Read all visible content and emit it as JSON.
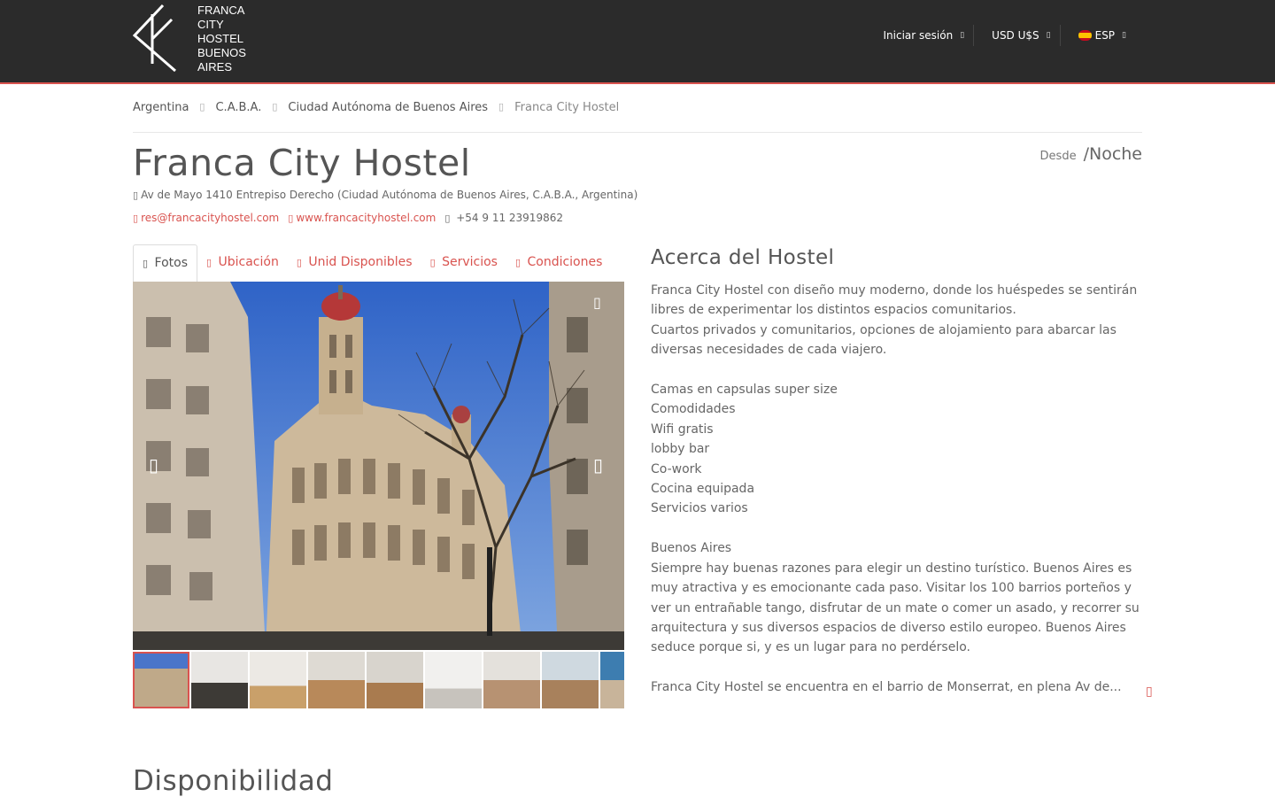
{
  "header": {
    "logo_lines": [
      "FRANCA",
      "CITY",
      "HOSTEL",
      "BUENOS",
      "AIRES"
    ],
    "login": "Iniciar sesión",
    "currency": "USD U$S",
    "language": "ESP"
  },
  "breadcrumb": [
    "Argentina",
    "C.A.B.A.",
    "Ciudad Autónoma de Buenos Aires",
    "Franca City Hostel"
  ],
  "hostel": {
    "name": "Franca City Hostel",
    "price_from": "Desde",
    "price_unit": "/Noche",
    "address": "Av de Mayo 1410 Entrepiso Derecho (Ciudad Autónoma de Buenos Aires, C.A.B.A., Argentina)",
    "email": "res@francacityhostel.com",
    "website": "www.francacityhostel.com",
    "phone": "+54 9 11 23919862"
  },
  "tabs": [
    "Fotos",
    "Ubicación",
    "Unid Disponibles",
    "Servicios",
    "Condiciones"
  ],
  "about": {
    "title": "Acerca del Hostel",
    "lines": [
      "Franca City Hostel con diseño muy moderno, donde los huéspedes se sentirán libres de experimentar los distintos espacios comunitarios.",
      "Cuartos privados y comunitarios, opciones de alojamiento para abarcar las diversas necesidades de cada viajero.",
      "",
      "Camas en capsulas super size",
      "Comodidades",
      "Wifi gratis",
      "lobby bar",
      "Co-work",
      "Cocina equipada",
      "Servicios varios",
      "",
      "Buenos Aires",
      "Siempre hay buenas razones para elegir un destino turístico. Buenos Aires es muy atractiva y es emocionante cada paso. Visitar los 100 barrios porteños y ver un entrañable tango, disfrutar de un mate o comer un asado, y recorrer su arquitectura y sus diversos espacios de diverso estilo europeo. Buenos Aires seduce porque si, y es un lugar para no perdérselo.",
      "",
      "Franca City Hostel se encuentra en el barrio de Monserrat, en plena Av de..."
    ]
  },
  "availability_title": "Disponibilidad",
  "colors": {
    "accent": "#d9534f",
    "header_bg": "#2b2b2b",
    "text": "#555555"
  },
  "icons": [
    "map-marker-icon",
    "envelope-icon",
    "globe-icon",
    "phone-icon",
    "camera-icon",
    "chevron-left-icon",
    "chevron-right-icon",
    "expand-icon"
  ]
}
